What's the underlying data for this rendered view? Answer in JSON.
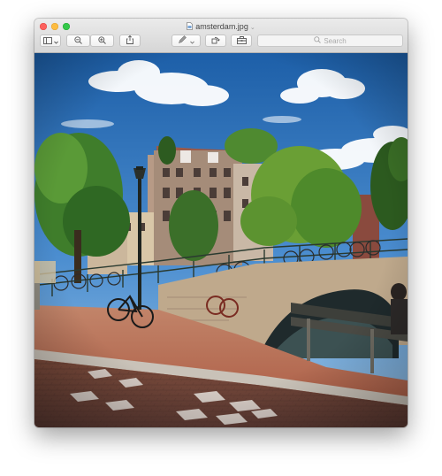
{
  "window": {
    "title": "amsterdam.jpg"
  },
  "toolbar": {
    "buttons": [
      {
        "name": "sidebar-toggle",
        "icon": "sidebar-icon"
      },
      {
        "name": "zoom-out",
        "icon": "zoom-out-icon"
      },
      {
        "name": "zoom-in",
        "icon": "zoom-in-icon"
      },
      {
        "name": "share",
        "icon": "share-icon"
      },
      {
        "name": "markup",
        "icon": "pen-icon"
      },
      {
        "name": "rotate",
        "icon": "rotate-icon"
      },
      {
        "name": "toolbox",
        "icon": "toolbox-icon"
      }
    ],
    "search_placeholder": "Search"
  },
  "document": {
    "image_subject": "Amsterdam canal bridge with bicycles, trees and townhouses"
  }
}
